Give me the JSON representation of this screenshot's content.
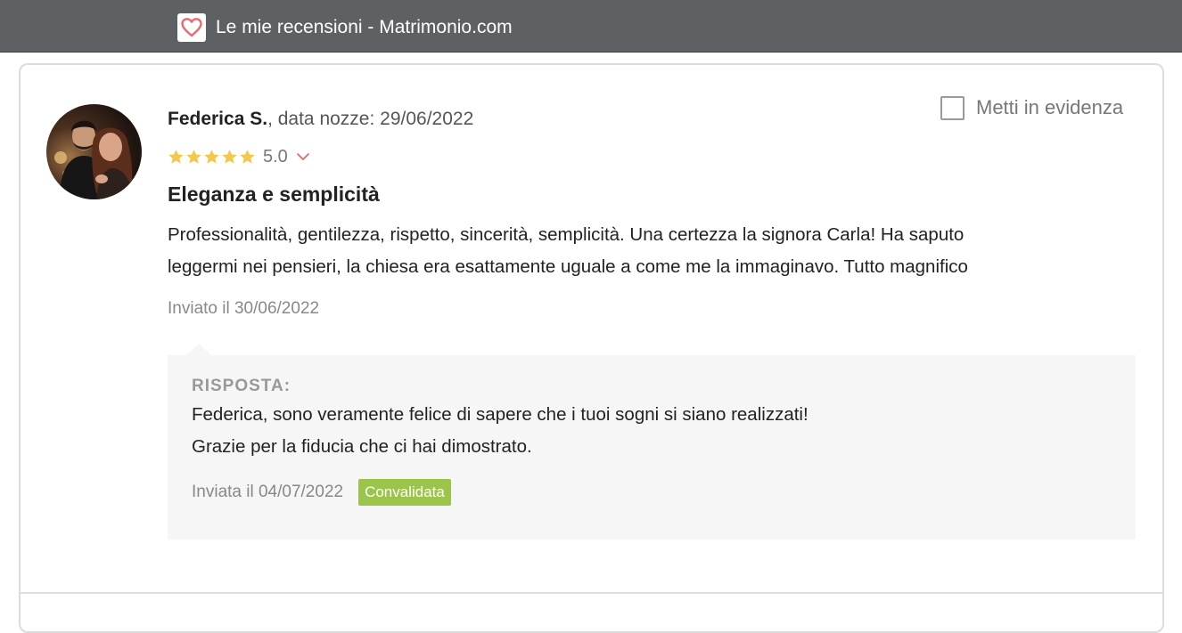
{
  "window": {
    "title": "Le mie recensioni - Matrimonio.com",
    "icon": "heart-logo-icon",
    "accent_color": "#e8686d"
  },
  "review": {
    "author": "Federica S.",
    "wedding_date_text": ", data nozze: 29/06/2022",
    "rating": 5.0,
    "rating_label": "5.0",
    "star_color": "#f2c94c",
    "feature_label": "Metti in evidenza",
    "feature_checked": false,
    "title": "Eleganza e semplicità",
    "body_lines": [
      "Professionalità, gentilezza, rispetto, sincerità, semplicità. Una certezza la signora Carla! Ha saputo",
      "leggermi nei pensieri, la chiesa era esattamente uguale a come me la immaginavo. Tutto magnifico"
    ],
    "sent_date": "Inviato il 30/06/2022"
  },
  "reply": {
    "heading": "RISPOSTA:",
    "body_lines": [
      "Federica, sono veramente felice di sapere che i tuoi sogni si siano realizzati!",
      "Grazie per la fiducia che ci hai dimostrato."
    ],
    "sent_date": "Inviata il 04/07/2022",
    "status": "Convalidata",
    "status_color": "#9bc44a"
  }
}
